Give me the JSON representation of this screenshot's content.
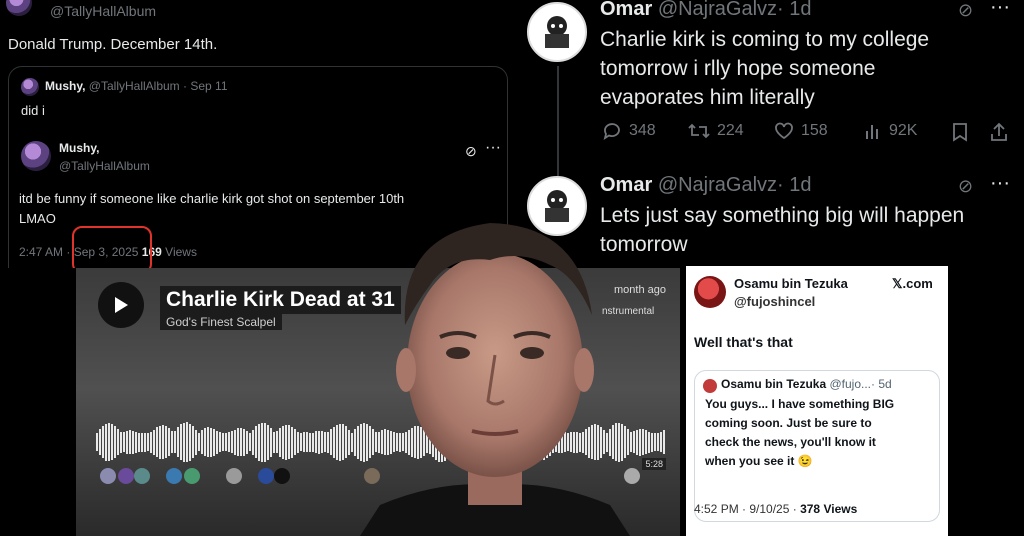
{
  "tweet1": {
    "handle": "@TallyHallAlbum",
    "text": "Donald Trump. December 14th.",
    "quote_header_name": "Mushy,",
    "quote_header_handle": "@TallyHallAlbum",
    "quote_header_date": "· Sep 11",
    "quote_text": "did i",
    "inner_name": "Mushy,",
    "inner_handle": "@TallyHallAlbum",
    "inner_text_line1": "itd be funny if someone like charlie kirk got shot on september 10th",
    "inner_text_line2": "LMAO",
    "time": "2:47 AM ·",
    "date": "Sep 3, 2025",
    "views_count": "169",
    "views_label": "Views"
  },
  "tweet2": {
    "name": "Omar",
    "handle": "@NajraGalvz",
    "age": "· 1d",
    "text_line1": "Charlie kirk is coming to my college",
    "text_line2": "tomorrow i rlly hope someone",
    "text_line3": "evaporates him literally",
    "replies": "348",
    "retweets": "224",
    "likes": "158",
    "views": "92K",
    "reply_name": "Omar",
    "reply_handle": "@NajraGalvz",
    "reply_age": "· 1d",
    "reply_line1": "Lets just say something big will happen",
    "reply_line2": "tomorrow"
  },
  "track": {
    "title": "Charlie Kirk Dead at 31",
    "artist": "God's Finest Scalpel",
    "posted": "month ago",
    "tag": "nstrumental",
    "duration": "5:28"
  },
  "tweet3": {
    "name": "Osamu bin Tezuka",
    "handle": "@fujoshincel",
    "source": "𝕏.com",
    "text": "Well that's that",
    "quote_name": "Osamu bin Tezuka",
    "quote_handle": "@fujo...",
    "quote_age": "· 5d",
    "quote_line1": "You guys... I have something BIG",
    "quote_line2": "coming soon. Just be sure to",
    "quote_line3": "check the news, you'll know it",
    "quote_line4": "when you see it 😉",
    "time_date": "4:52 PM · 9/10/25 ·",
    "views_count": "378",
    "views_label": "Views"
  },
  "colors": {
    "x_dark_bg": "#000000",
    "x_muted": "#71767b",
    "highlight_red": "#e0332b"
  }
}
